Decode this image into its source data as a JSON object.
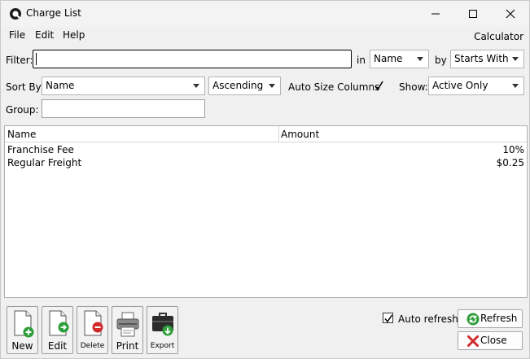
{
  "window": {
    "title": "Charge List"
  },
  "menu": {
    "file": "File",
    "edit": "Edit",
    "help": "Help",
    "calculator": "Calculator"
  },
  "filter": {
    "label": "Filter:",
    "value": "",
    "in_label": "in",
    "in_value": "Name",
    "by_label": "by",
    "by_value": "Starts With"
  },
  "sort": {
    "label": "Sort By:",
    "field": "Name",
    "order": "Ascending",
    "auto_size_label": "Auto Size Columns",
    "auto_size_checked": true,
    "show_label": "Show:",
    "show_value": "Active Only"
  },
  "group": {
    "label": "Group:",
    "value": ""
  },
  "table": {
    "columns": [
      "Name",
      "Amount"
    ],
    "rows": [
      {
        "name": "Franchise Fee",
        "amount": "10%"
      },
      {
        "name": "Regular Freight",
        "amount": "$0.25"
      }
    ]
  },
  "toolbar": {
    "new": "New",
    "edit": "Edit",
    "delete": "Delete",
    "print": "Print",
    "export": "Export"
  },
  "footer": {
    "auto_refresh_label": "Auto refresh",
    "auto_refresh_checked": true,
    "refresh": "Refresh",
    "close": "Close"
  },
  "colors": {
    "accent_green": "#2e9e3a",
    "close_red": "#d12a2a"
  }
}
